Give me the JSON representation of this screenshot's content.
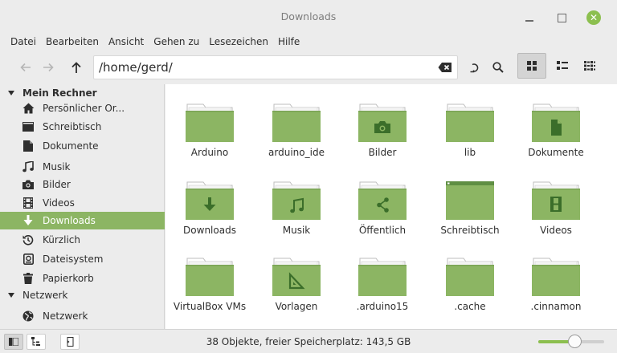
{
  "window": {
    "title": "Downloads",
    "accent": "#8cbf4f"
  },
  "menu": [
    "Datei",
    "Bearbeiten",
    "Ansicht",
    "Gehen zu",
    "Lesezeichen",
    "Hilfe"
  ],
  "toolbar": {
    "path": "/home/gerd/"
  },
  "sidebar": {
    "sections": {
      "computer": "Mein Rechner",
      "network": "Netzwerk"
    },
    "items": [
      {
        "label": "Persönlicher Or...",
        "icon": "home-icon"
      },
      {
        "label": "Schreibtisch",
        "icon": "desktop-icon"
      },
      {
        "label": "Dokumente",
        "icon": "document-icon"
      },
      {
        "label": "Musik",
        "icon": "music-icon"
      },
      {
        "label": "Bilder",
        "icon": "camera-icon"
      },
      {
        "label": "Videos",
        "icon": "film-icon"
      },
      {
        "label": "Downloads",
        "icon": "download-icon",
        "selected": true
      },
      {
        "label": "Kürzlich",
        "icon": "history-icon"
      },
      {
        "label": "Dateisystem",
        "icon": "drive-icon"
      },
      {
        "label": "Papierkorb",
        "icon": "trash-icon"
      }
    ],
    "network_items": [
      {
        "label": "Netzwerk",
        "icon": "globe-icon"
      }
    ]
  },
  "files": [
    {
      "name": "Arduino",
      "emblem": "none"
    },
    {
      "name": "arduino_ide",
      "emblem": "none"
    },
    {
      "name": "Bilder",
      "emblem": "camera"
    },
    {
      "name": "lib",
      "emblem": "none"
    },
    {
      "name": "Dokumente",
      "emblem": "document"
    },
    {
      "name": "Downloads",
      "emblem": "download"
    },
    {
      "name": "Musik",
      "emblem": "music"
    },
    {
      "name": "Öffentlich",
      "emblem": "share"
    },
    {
      "name": "Schreibtisch",
      "emblem": "desktop"
    },
    {
      "name": "Videos",
      "emblem": "film"
    },
    {
      "name": "VirtualBox VMs",
      "emblem": "none"
    },
    {
      "name": "Vorlagen",
      "emblem": "template"
    },
    {
      "name": ".arduino15",
      "emblem": "none"
    },
    {
      "name": ".cache",
      "emblem": "none"
    },
    {
      "name": ".cinnamon",
      "emblem": "none"
    }
  ],
  "status": {
    "text": "38 Objekte, freier Speicherplatz: 143,5 GB",
    "zoom_fraction": 0.55
  }
}
